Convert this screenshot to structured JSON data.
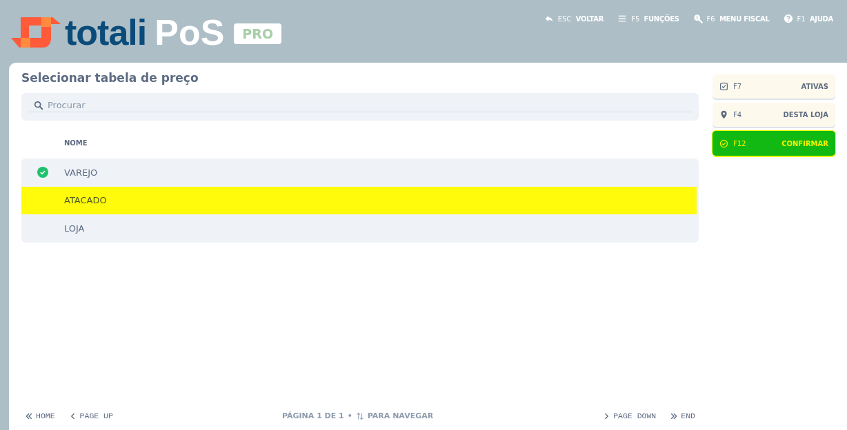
{
  "logo": {
    "wordmark": "totali",
    "product": "PoS",
    "badge": "PRO"
  },
  "shortcuts": [
    {
      "key": "ESC",
      "label": "VOLTAR"
    },
    {
      "key": "F5",
      "label": "FUNÇÕES"
    },
    {
      "key": "F6",
      "label": "MENU FISCAL"
    },
    {
      "key": "F1",
      "label": "AJUDA"
    }
  ],
  "title": "Selecionar tabela de preço",
  "search": {
    "placeholder": "Procurar"
  },
  "table": {
    "columns": [
      "NOME"
    ],
    "rows": [
      {
        "name": "VAREJO",
        "checked": true,
        "selected": false
      },
      {
        "name": "ATACADO",
        "checked": false,
        "selected": true
      },
      {
        "name": "LOJA",
        "checked": false,
        "selected": false
      }
    ]
  },
  "actions": [
    {
      "kind": "filter",
      "key": "F7",
      "label": "ATIVAS"
    },
    {
      "kind": "filter",
      "key": "F4",
      "label": "DESTA LOJA"
    },
    {
      "kind": "primary",
      "key": "F12",
      "label": "CONFIRMAR"
    }
  ],
  "pager": {
    "left": [
      {
        "label": "HOME"
      },
      {
        "label": "PAGE UP"
      }
    ],
    "status": "PÁGINA 1 DE 1",
    "separator": "•",
    "hint": "PARA NAVEGAR",
    "right": [
      {
        "label": "PAGE DOWN"
      },
      {
        "label": "END"
      }
    ]
  }
}
